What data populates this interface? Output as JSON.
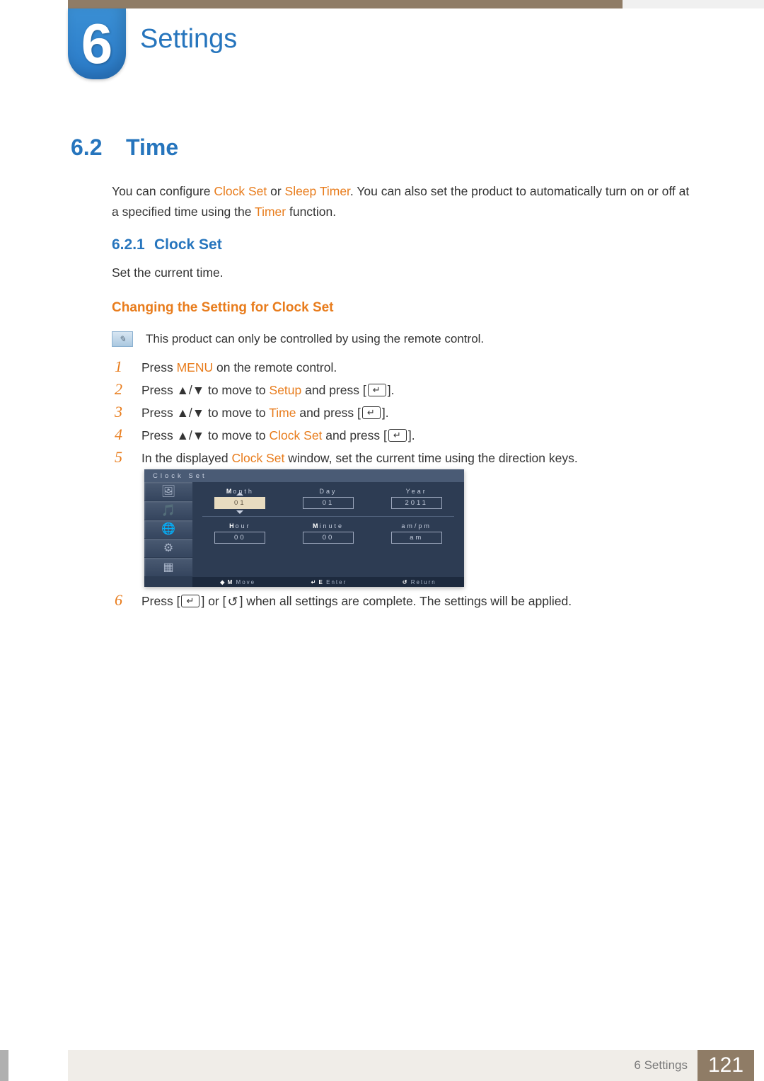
{
  "chapter": {
    "number": "6",
    "title": "Settings"
  },
  "section": {
    "number": "6.2",
    "title": "Time"
  },
  "intro": {
    "p1a": "You can configure ",
    "p1b": "Clock Set",
    "p1c": " or ",
    "p1d": "Sleep Timer",
    "p1e": ". You can also set the product to automatically turn on or off at a specified time using the ",
    "p1f": "Timer",
    "p1g": " function."
  },
  "subsection": {
    "number": "6.2.1",
    "title": "Clock Set",
    "desc": "Set the current time."
  },
  "changing_title": "Changing the Setting for Clock Set",
  "note_text": "This product can only be controlled by using the remote control.",
  "steps": {
    "s1": {
      "num": "1",
      "a": "Press ",
      "b": "MENU",
      "c": " on the remote control."
    },
    "s2": {
      "num": "2",
      "a": "Press ▲/▼ to move to ",
      "b": "Setup",
      "c": " and press [",
      "d": "]."
    },
    "s3": {
      "num": "3",
      "a": "Press ▲/▼ to move to ",
      "b": "Time",
      "c": " and press [",
      "d": "]."
    },
    "s4": {
      "num": "4",
      "a": "Press ▲/▼ to move to ",
      "b": "Clock Set",
      "c": " and press [",
      "d": "]."
    },
    "s5": {
      "num": "5",
      "a": "In the displayed ",
      "b": "Clock Set",
      "c": " window, set the current time using the direction keys."
    },
    "s6": {
      "num": "6",
      "a": "Press [",
      "b": "] or [",
      "c": "] when all settings are complete. The settings will be applied."
    }
  },
  "osd": {
    "title": "Clock Set",
    "row1": {
      "c1_label": "Month",
      "c1_val": "01",
      "c2_label": "Day",
      "c2_val": "01",
      "c3_label": "Year",
      "c3_val": "2011"
    },
    "row2": {
      "c1_label": "Hour",
      "c1_val": "00",
      "c2_label": "Minute",
      "c2_val": "00",
      "c3_label": "am/pm",
      "c3_val": "am"
    },
    "footer": {
      "f1": "Move",
      "f2": "Enter",
      "f3": "Return"
    }
  },
  "footer": {
    "crumb": "6 Settings",
    "pageno": "121"
  }
}
